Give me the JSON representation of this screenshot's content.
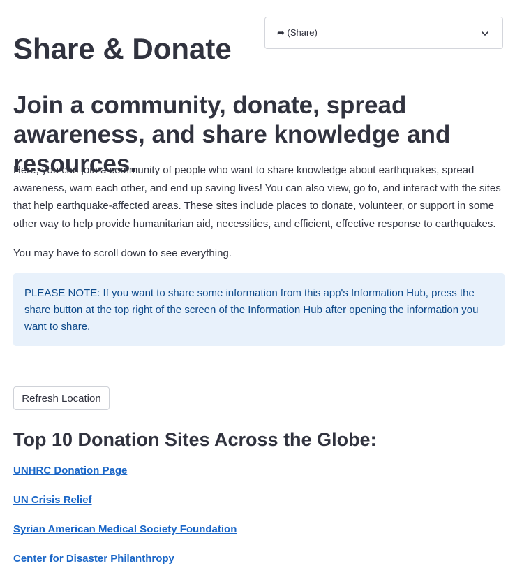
{
  "page": {
    "title": "Share & Donate",
    "subheading": "Join a community, donate, spread awareness, and share knowledge and resources.",
    "intro": "Here, you can join a community of people who want to share knowledge about earthquakes, spread awareness, warn each other, and end up saving lives! You can also view, go to, and interact with the sites that help earthquake-affected areas. These sites include places to donate, volunteer, or support in some other way to help provide humanitarian aid, necessities, and efficient, effective response to earthquakes.",
    "scroll_note": "You may have to scroll down to see everything."
  },
  "share_select": {
    "value": "➦ (Share)",
    "icon": "chevron-down-icon"
  },
  "notice": {
    "text": "PLEASE NOTE: If you want to share some information from this app's Information Hub, press the share button at the top right of the screen of the Information Hub after opening the information you want to share.",
    "color": "#e8f1fb"
  },
  "refresh_button": {
    "label": "Refresh Location"
  },
  "donation_section": {
    "title": "Top 10 Donation Sites Across the Globe:",
    "links": [
      "UNHRC Donation Page",
      "UN Crisis Relief",
      "Syrian American Medical Society Foundation",
      "Center for Disaster Philanthropy"
    ],
    "link_color": "#1a66c7"
  }
}
